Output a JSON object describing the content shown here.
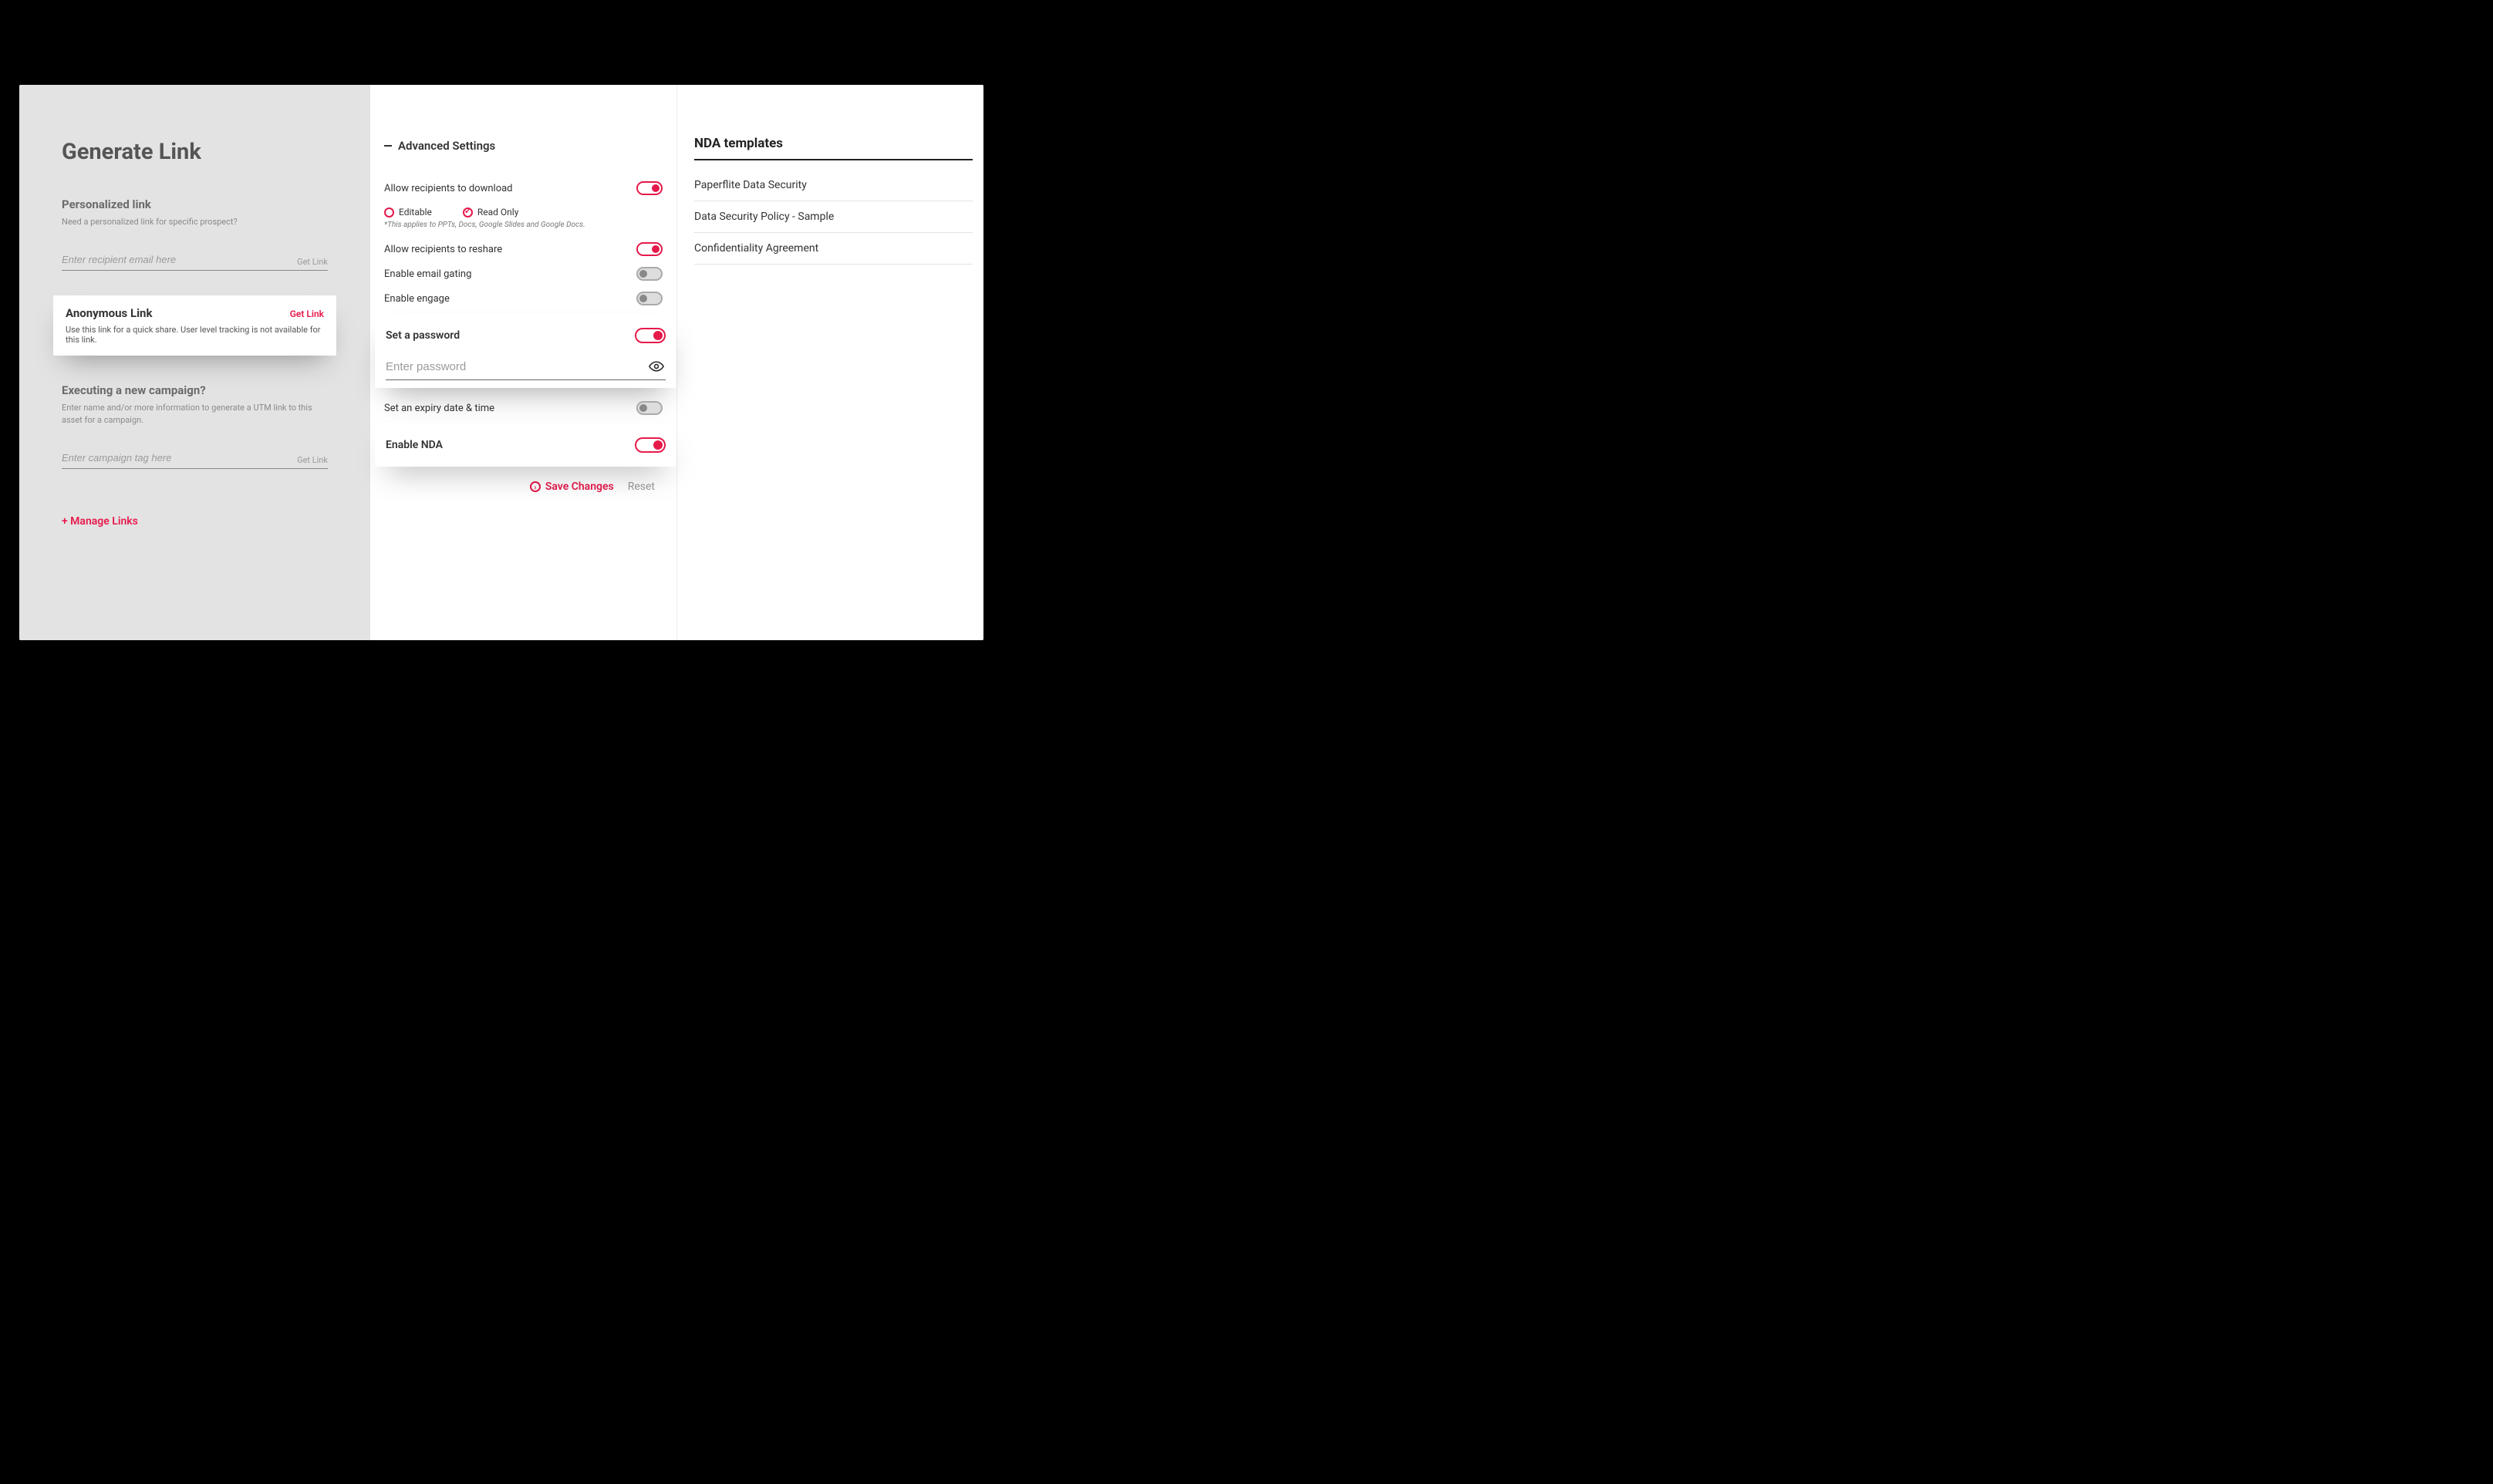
{
  "left": {
    "title": "Generate Link",
    "personalized": {
      "heading": "Personalized link",
      "sub": "Need a personalized link for specific prospect?",
      "placeholder": "Enter recipient email here",
      "get_link_label": "Get Link"
    },
    "anonymous": {
      "heading": "Anonymous Link",
      "get_link_label": "Get Link",
      "desc": "Use this link for a quick share. User level tracking is not available for this link."
    },
    "campaign": {
      "heading": "Executing a new campaign?",
      "sub": "Enter name and/or more information to generate a UTM link to this asset for a campaign.",
      "placeholder": "Enter campaign tag here",
      "get_link_label": "Get Link"
    },
    "manage_links_label": "+ Manage Links"
  },
  "settings": {
    "heading": "Advanced Settings",
    "allow_download": {
      "label": "Allow recipients to download",
      "value": true
    },
    "edit_mode": {
      "editable_label": "Editable",
      "readonly_label": "Read Only",
      "selected": "readonly",
      "note": "*This applies to PPTs, Docs, Google Slides and Google Docs."
    },
    "allow_reshare": {
      "label": "Allow recipients to reshare",
      "value": true
    },
    "email_gating": {
      "label": "Enable email gating",
      "value": false
    },
    "enable_engage": {
      "label": "Enable engage",
      "value": false
    },
    "set_password": {
      "label": "Set a password",
      "value": true,
      "placeholder": "Enter password"
    },
    "set_expiry": {
      "label": "Set an expiry date & time",
      "value": false
    },
    "enable_nda": {
      "label": "Enable NDA",
      "value": true
    },
    "save_label": "Save Changes",
    "reset_label": "Reset"
  },
  "nda": {
    "heading": "NDA templates",
    "items": [
      "Paperflite Data Security",
      "Data Security Policy - Sample",
      "Confidentiality Agreement"
    ]
  }
}
